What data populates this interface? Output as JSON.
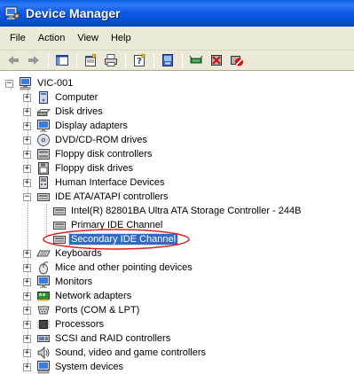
{
  "window": {
    "title": "Device Manager"
  },
  "menu": {
    "items": [
      "File",
      "Action",
      "View",
      "Help"
    ]
  },
  "toolbar": {
    "buttons": [
      "back-icon",
      "forward-icon",
      "show-hide-tree-icon",
      "properties-icon",
      "print-icon",
      "help-icon",
      "scan-hardware-icon",
      "update-driver-icon",
      "uninstall-icon",
      "disable-icon"
    ]
  },
  "tree": {
    "root": "VIC-001",
    "items": [
      {
        "label": "Computer",
        "icon": "computer-icon"
      },
      {
        "label": "Disk drives",
        "icon": "disk-drive-icon"
      },
      {
        "label": "Display adapters",
        "icon": "display-adapter-icon"
      },
      {
        "label": "DVD/CD-ROM drives",
        "icon": "cdrom-icon"
      },
      {
        "label": "Floppy disk controllers",
        "icon": "floppy-controller-icon"
      },
      {
        "label": "Floppy disk drives",
        "icon": "floppy-drive-icon"
      },
      {
        "label": "Human Interface Devices",
        "icon": "hid-icon"
      },
      {
        "label": "IDE ATA/ATAPI controllers",
        "icon": "ide-controller-icon"
      },
      {
        "label": "Intel(R) 82801BA Ultra ATA Storage Controller - 244B",
        "icon": "ide-controller-icon"
      },
      {
        "label": "Primary IDE Channel",
        "icon": "ide-controller-icon"
      },
      {
        "label": "Secondary IDE Channel",
        "icon": "ide-controller-icon"
      },
      {
        "label": "Keyboards",
        "icon": "keyboard-icon"
      },
      {
        "label": "Mice and other pointing devices",
        "icon": "mouse-icon"
      },
      {
        "label": "Monitors",
        "icon": "monitor-icon"
      },
      {
        "label": "Network adapters",
        "icon": "network-adapter-icon"
      },
      {
        "label": "Ports (COM & LPT)",
        "icon": "ports-icon"
      },
      {
        "label": "Processors",
        "icon": "processor-icon"
      },
      {
        "label": "SCSI and RAID controllers",
        "icon": "scsi-icon"
      },
      {
        "label": "Sound, video and game controllers",
        "icon": "sound-icon"
      },
      {
        "label": "System devices",
        "icon": "system-devices-icon"
      }
    ],
    "selected": "Secondary IDE Channel",
    "annotation_color": "#e02020"
  },
  "colors": {
    "title_blue": "#0054e3",
    "chrome": "#ece9d8",
    "selection": "#316ac5"
  }
}
